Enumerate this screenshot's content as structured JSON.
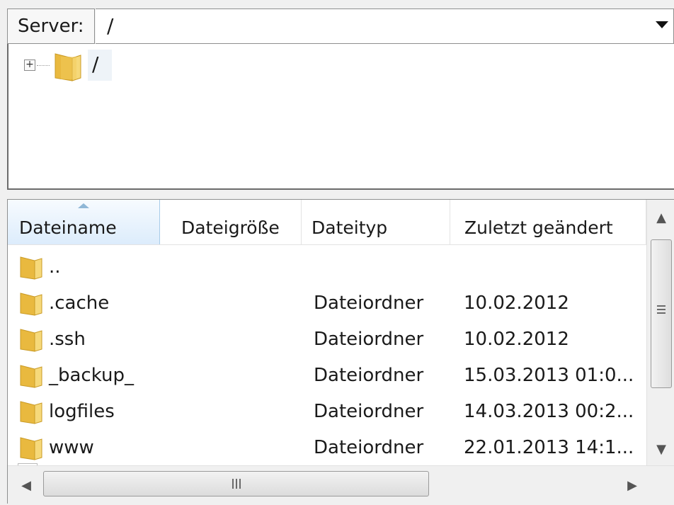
{
  "server_bar": {
    "label": "Server:",
    "path_value": "/"
  },
  "tree": {
    "root_label": "/",
    "expander": "+"
  },
  "file_list": {
    "columns": [
      "Dateiname",
      "Dateigröße",
      "Dateityp",
      "Zuletzt geändert"
    ],
    "sorted_column": "Dateiname",
    "rows": [
      {
        "name": "..",
        "size": "",
        "type": "",
        "modified": ""
      },
      {
        "name": ".cache",
        "size": "",
        "type": "Dateiordner",
        "modified": "10.02.2012"
      },
      {
        "name": ".ssh",
        "size": "",
        "type": "Dateiordner",
        "modified": "10.02.2012"
      },
      {
        "name": "_backup_",
        "size": "",
        "type": "Dateiordner",
        "modified": "15.03.2013 01:0..."
      },
      {
        "name": "logfiles",
        "size": "",
        "type": "Dateiordner",
        "modified": "14.03.2013 00:2..."
      },
      {
        "name": "www",
        "size": "",
        "type": "Dateiordner",
        "modified": "22.01.2013 14:1..."
      }
    ]
  },
  "icons": {
    "folder": "folder-icon",
    "expander": "plus-box-icon",
    "dropdown": "chevron-down-icon"
  },
  "colors": {
    "header_sorted_bg": "#dcecfc",
    "folder_yellow": "#f2cb5c"
  }
}
